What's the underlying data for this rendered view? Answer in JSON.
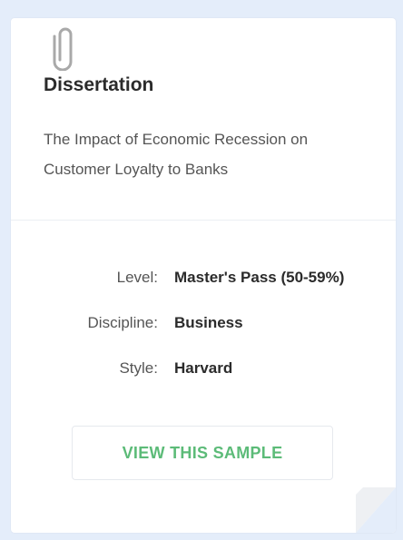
{
  "card": {
    "type": "Dissertation",
    "topic": "The Impact of Economic Recession on Customer Loyalty to Banks",
    "details": [
      {
        "label": "Level:",
        "value": "Master's Pass (50-59%)"
      },
      {
        "label": "Discipline:",
        "value": "Business"
      },
      {
        "label": "Style:",
        "value": "Harvard"
      }
    ],
    "button_label": "VIEW THIS SAMPLE"
  },
  "colors": {
    "background": "#e4edfa",
    "card": "#ffffff",
    "accent": "#5cbb78",
    "title": "#2b2b2b",
    "muted": "#555555"
  },
  "icons": {
    "attachment": "paperclip-icon"
  }
}
